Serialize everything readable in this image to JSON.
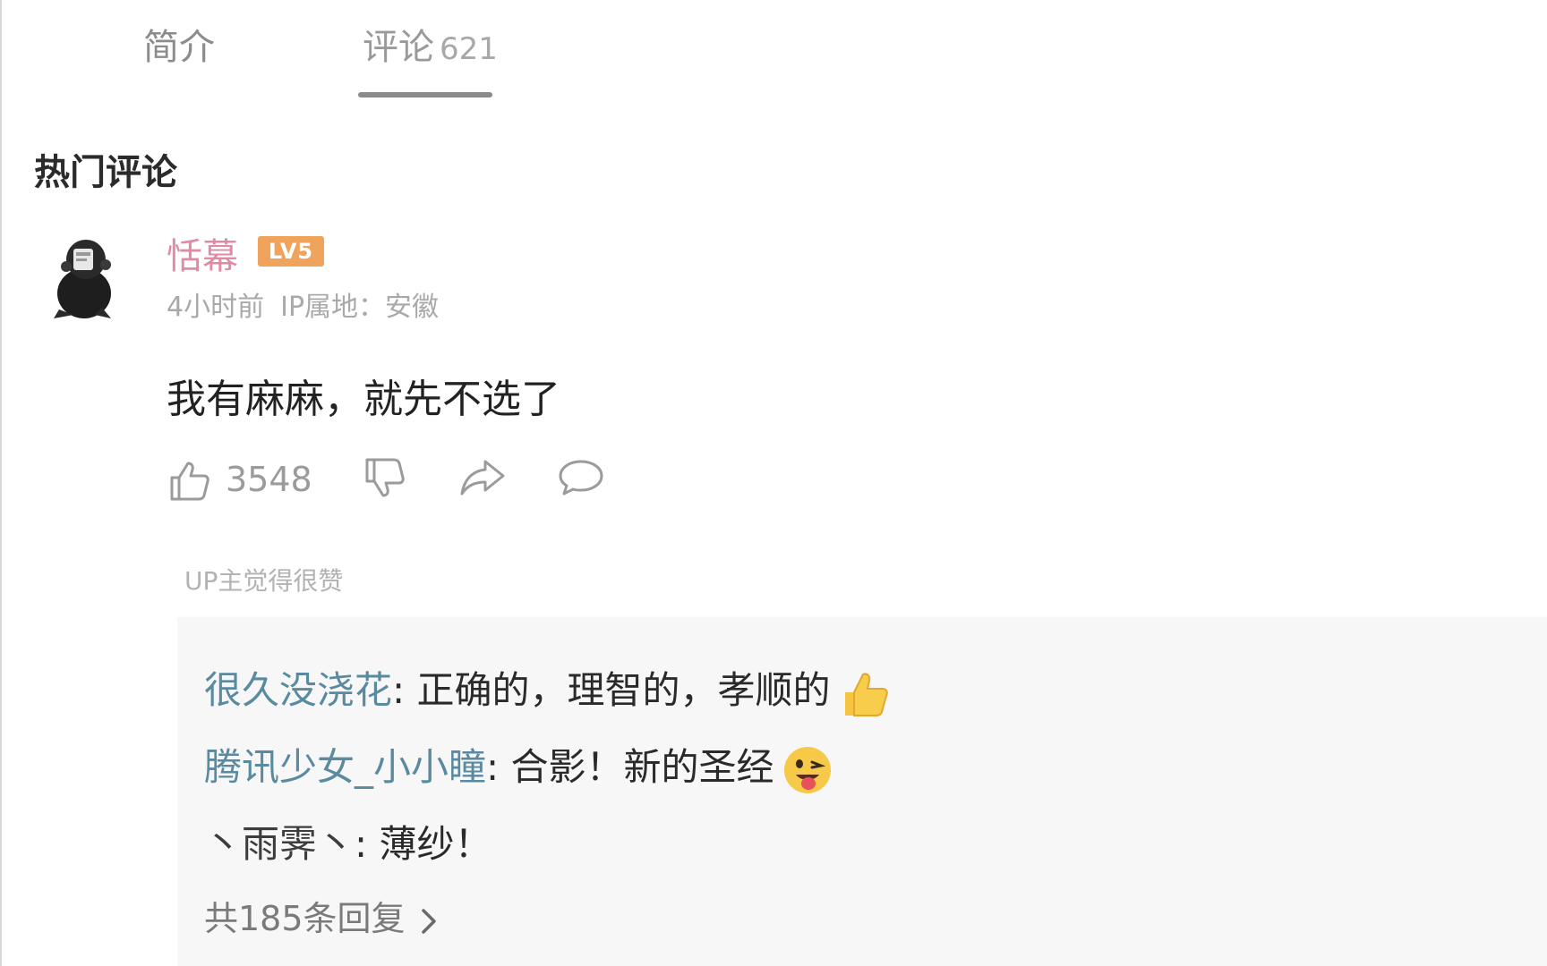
{
  "tabs": {
    "intro": "简介",
    "comments": "评论",
    "comments_count": "621"
  },
  "section_title": "热门评论",
  "comment": {
    "username": "恬幕",
    "level": "LV5",
    "time": "4小时前",
    "ip_location": "IP属地：安徽",
    "text": "我有麻麻，就先不选了",
    "likes": "3548",
    "up_liked": "UP主觉得很赞",
    "icons": [
      "thumbs-up-icon",
      "thumbs-down-icon",
      "share-icon",
      "reply-bubble-icon"
    ]
  },
  "replies": [
    {
      "name": "很久没浇花",
      "sep": ":",
      "text": " 正确的，理智的，孝顺的",
      "emoji": "thumbs-up-emoji"
    },
    {
      "name": "腾讯少女_小小瞳",
      "sep": ":",
      "text": " 合影！新的圣经",
      "emoji": "tongue-out-emoji"
    },
    {
      "name": "丶雨霁丶",
      "sep": ":",
      "text": " 薄纱！",
      "emoji": ""
    }
  ],
  "more_replies": "共185条回复",
  "colors": {
    "username": "#e08aa3",
    "level_badge": "#f0a35a",
    "reply_name": "#5a8aa0",
    "panel_bg": "#f7f7f7"
  }
}
